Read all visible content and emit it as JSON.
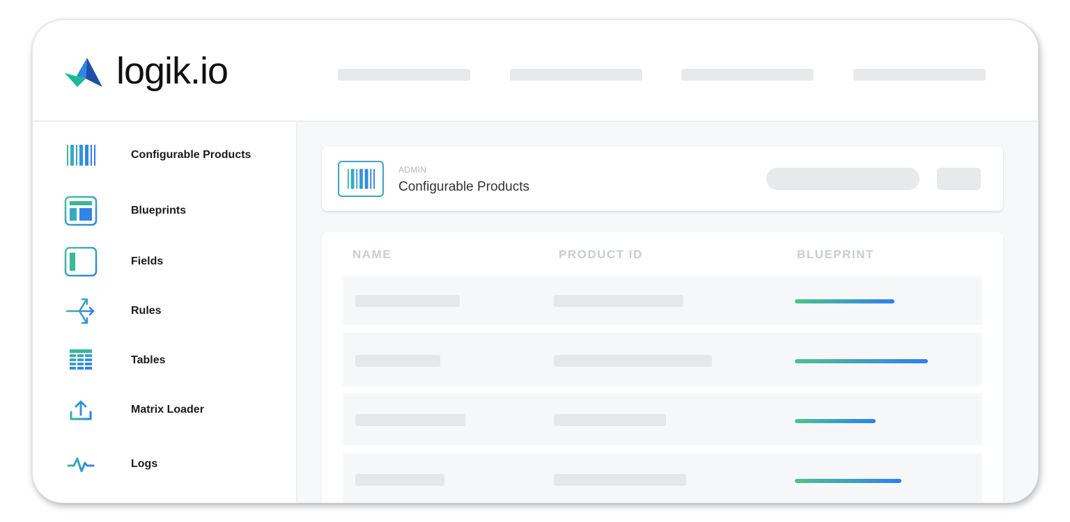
{
  "app": {
    "logo_text": "logik.io"
  },
  "sidebar": {
    "items": [
      {
        "label": "Configurable Products",
        "icon": "barcode-icon"
      },
      {
        "label": "Blueprints",
        "icon": "blueprint-layout-icon"
      },
      {
        "label": "Fields",
        "icon": "field-panel-icon"
      },
      {
        "label": "Rules",
        "icon": "rules-branch-icon"
      },
      {
        "label": "Tables",
        "icon": "table-grid-icon"
      },
      {
        "label": "Matrix Loader",
        "icon": "upload-icon"
      },
      {
        "label": "Logs",
        "icon": "pulse-icon"
      }
    ]
  },
  "page": {
    "section_label": "ADMIN",
    "title": "Configurable Products"
  },
  "table": {
    "columns": [
      "NAME",
      "PRODUCT ID",
      "BLUEPRINT"
    ],
    "row_count": 4
  },
  "colors": {
    "accent_start": "#4cc38a",
    "accent_end": "#2f7ff0",
    "icon_teal": "#3ba3c9"
  }
}
